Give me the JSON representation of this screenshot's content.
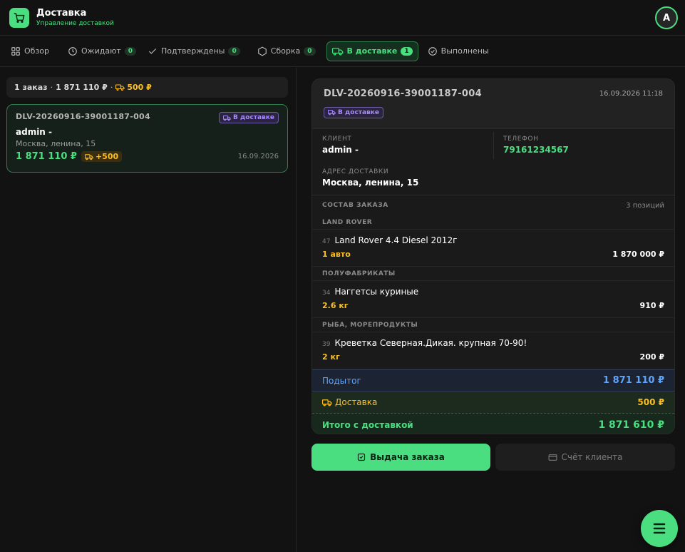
{
  "app": {
    "title": "Доставка",
    "subtitle": "Управление доставкой",
    "avatar_letter": "A"
  },
  "tabs": [
    {
      "label": "Обзор",
      "icon": "grid-icon"
    },
    {
      "label": "Ожидают",
      "icon": "clock-icon",
      "count": "0"
    },
    {
      "label": "Подтверждены",
      "icon": "check-icon",
      "count": "0"
    },
    {
      "label": "Сборка",
      "icon": "box-icon",
      "count": "0"
    },
    {
      "label": "В доставке",
      "icon": "truck-icon",
      "count": "1",
      "active": true
    },
    {
      "label": "Выполнены",
      "icon": "check-circle-icon"
    }
  ],
  "summary": {
    "orders": "1 заказ",
    "sep1": "·",
    "sum": "1 871 110 ₽",
    "sep2": "·",
    "delivery": "500 ₽"
  },
  "order_card": {
    "id": "DLV-20260916-39001187-004",
    "status": "В доставке",
    "client": "admin -",
    "address": "Москва, ленина, 15",
    "total": "1 871 110 ₽",
    "delivery": "+500",
    "date": "16.09.2026"
  },
  "detail": {
    "id": "DLV-20260916-39001187-004",
    "datetime": "16.09.2026 11:18",
    "status": "В доставке",
    "client_label": "КЛИЕНТ",
    "client": "admin -",
    "phone_label": "ТЕЛЕФОН",
    "phone": "79161234567",
    "address_label": "АДРЕС ДОСТАВКИ",
    "address": "Москва, ленина, 15",
    "composition_label": "СОСТАВ ЗАКАЗА",
    "positions_count": "3 позиций",
    "categories": [
      {
        "name": "LAND ROVER",
        "items": [
          {
            "num": "47",
            "name": "Land Rover 4.4 Diesel 2012г",
            "qty": "1 авто",
            "price": "1 870 000 ₽"
          }
        ]
      },
      {
        "name": "ПОЛУФАБРИКАТЫ",
        "items": [
          {
            "num": "34",
            "name": "Наггетсы куриные",
            "qty": "2.6 кг",
            "price": "910 ₽"
          }
        ]
      },
      {
        "name": "РЫБА, МОРЕПРОДУКТЫ",
        "items": [
          {
            "num": "39",
            "name": "Креветка Северная.Дикая. крупная 70-90!",
            "qty": "2 кг",
            "price": "200 ₽"
          }
        ]
      }
    ],
    "subtotal_label": "Подытог",
    "subtotal": "1 871 110 ₽",
    "delivery_label": "Доставка",
    "delivery": "500 ₽",
    "total_label": "Итого с доставкой",
    "total": "1 871 610 ₽"
  },
  "actions": {
    "issue": "Выдача заказа",
    "account": "Счёт клиента"
  },
  "colors": {
    "accent": "#4ade80",
    "delivery": "#fbbf24",
    "subtotal": "#60a5fa",
    "status_badge": "#a78bfa"
  }
}
